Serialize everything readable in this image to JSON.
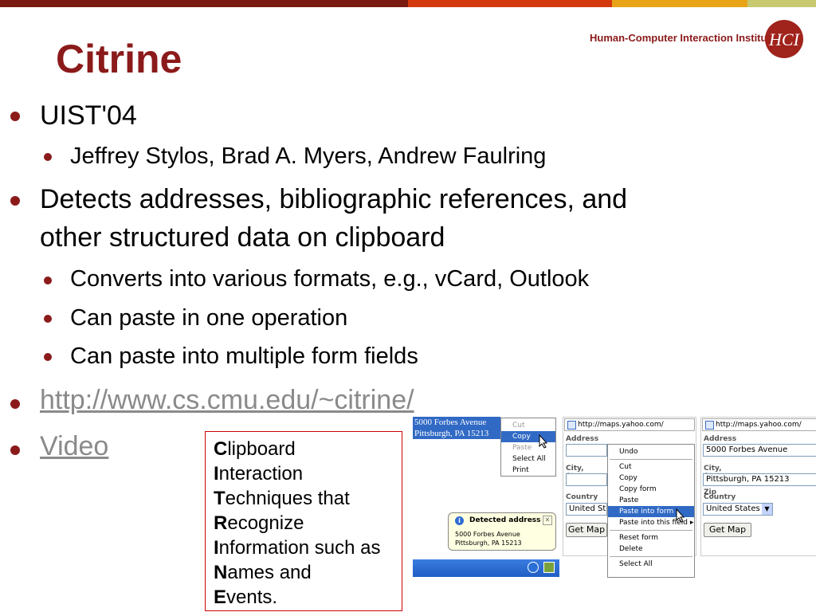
{
  "slide": {
    "title": "Citrine",
    "institute": "Human-Computer Interaction Institute",
    "logo_text": "HCI"
  },
  "bullets": {
    "b1": "UIST'04",
    "b1_sub1": "Jeffrey Stylos, Brad A. Myers, Andrew Faulring",
    "b2_line1": "Detects addresses, bibliographic references, and",
    "b2_line2": "other structured data on clipboard",
    "b2_sub1": "Converts into various formats, e.g., vCard, Outlook",
    "b2_sub2": "Can paste in one operation",
    "b2_sub3": "Can paste into multiple form fields",
    "link_url": "http://www.cs.cmu.edu/~citrine/",
    "link_video": "Video"
  },
  "acronym": [
    {
      "letter": "C",
      "rest": "lipboard"
    },
    {
      "letter": "I",
      "rest": "nteraction"
    },
    {
      "letter": "T",
      "rest": "echniques that"
    },
    {
      "letter": "R",
      "rest": "ecognize"
    },
    {
      "letter": "I",
      "rest": "nformation such as"
    },
    {
      "letter": "N",
      "rest": "ames and"
    },
    {
      "letter": "E",
      "rest": "vents."
    }
  ],
  "screenshot": {
    "selected_text_line1": "5000 Forbes Avenue",
    "selected_text_line2": "Pittsburgh, PA 15213",
    "edit_menu": [
      "Cut",
      "Copy",
      "Paste",
      "Select All",
      "Print"
    ],
    "balloon_title": "Detected address",
    "balloon_line1": "5000 Forbes Avenue",
    "balloon_line2": "Pittsburgh, PA 15213",
    "url": "http://maps.yahoo.com/",
    "label_address": "Address",
    "label_city": "City, State",
    "label_city_full": "City, State or Zip",
    "label_country": "Country",
    "country_value_short": "United St",
    "country_value": "United States",
    "get_map": "Get Map",
    "get_map_short": "Get Map",
    "context_menu": [
      "Undo",
      "Cut",
      "Copy",
      "Copy form",
      "Paste",
      "Paste into form",
      "Paste into this field",
      "Reset form",
      "Delete",
      "Select All"
    ],
    "filled_address": "5000 Forbes Avenue",
    "filled_city": "Pittsburgh, PA 15213"
  },
  "colors": {
    "accent": "#8b1a1a",
    "bar": [
      "#7a1a10",
      "#d4380d",
      "#e8a317",
      "#c8c870"
    ]
  }
}
